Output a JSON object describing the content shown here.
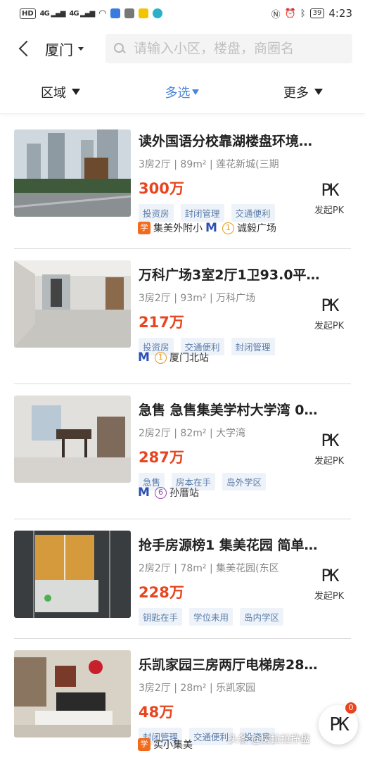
{
  "status_bar": {
    "hd": "HD",
    "net1": "4G",
    "net2": "4G",
    "battery": "39",
    "time": "4:23"
  },
  "header": {
    "city": "厦门",
    "search_placeholder": "请输入小区，楼盘，商圈名"
  },
  "filters": {
    "region": "区域",
    "multi": "多选",
    "more": "更多"
  },
  "listings": [
    {
      "title": "读外国语分校靠湖楼盘环境…",
      "meta": "3房2厅 | 89m² | 莲花新城(三期",
      "price": "300万",
      "tags": [
        "投资房",
        "封闭管理",
        "交通便利"
      ],
      "pk_label": "发起PK",
      "school": "集美外附小",
      "line": "1",
      "station": "诚毅广场"
    },
    {
      "title": "万科广场3室2厅1卫93.0平…",
      "meta": "3房2厅 | 93m² | 万科广场",
      "price": "217万",
      "tags": [
        "投资房",
        "交通便利",
        "封闭管理"
      ],
      "pk_label": "发起PK",
      "line": "1",
      "station": "厦门北站"
    },
    {
      "title": "急售 急售集美学村大学湾 0…",
      "meta": "2房2厅 | 82m² | 大学湾",
      "price": "287万",
      "tags": [
        "急售",
        "房本在手",
        "岛外学区"
      ],
      "pk_label": "发起PK",
      "line": "6",
      "station": "孙厝站"
    },
    {
      "title": "抢手房源榜1 集美花园 简单…",
      "meta": "2房2厅 | 78m² | 集美花园(东区",
      "price": "228万",
      "tags": [
        "钥匙在手",
        "学位未用",
        "岛内学区"
      ],
      "pk_label": "发起PK"
    },
    {
      "title": "乐凯家园三房两厅电梯房28…",
      "meta": "3房2厅 | 28m² | 乐凯家园",
      "price": "48万",
      "tags": [
        "封闭管理",
        "交通便利",
        "投资房"
      ],
      "school": "实小集美"
    }
  ],
  "pk_glyph": "PK",
  "school_badge": "学",
  "float_pk": {
    "count": "0"
  },
  "watermark": "头条 @房拉拉挣盘",
  "colors": {
    "accent": "#4a86d8",
    "price": "#e8451f",
    "tag_text": "#5a7ba8"
  }
}
